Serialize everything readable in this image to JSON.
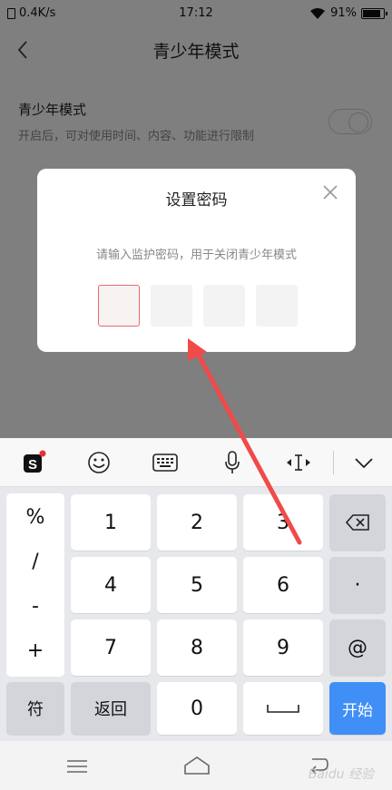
{
  "status_bar": {
    "speed": "0.4K/s",
    "time": "17:12",
    "battery": "91%"
  },
  "header": {
    "title": "青少年模式"
  },
  "setting": {
    "name": "青少年模式",
    "description": "开启后，可对使用时间、内容、功能进行限制"
  },
  "dialog": {
    "title": "设置密码",
    "hint": "请输入监护密码，用于关闭青少年模式",
    "pin_boxes": [
      "",
      "",
      "",
      ""
    ]
  },
  "keyboard": {
    "symbols": [
      "%",
      "/",
      "-",
      "+"
    ],
    "row1": [
      "1",
      "2",
      "3"
    ],
    "row2": [
      "4",
      "5",
      "6"
    ],
    "row3": [
      "7",
      "8",
      "9"
    ],
    "dot": "·",
    "at": "@",
    "fu_label": "符",
    "back_label": "返回",
    "zero": "0",
    "enter_label": "开始"
  },
  "watermark": "Baidu 经验",
  "colors": {
    "accent_blue": "#3f8ff6",
    "active_pin_border": "#e86a6a",
    "arrow": "#f04a4a"
  }
}
